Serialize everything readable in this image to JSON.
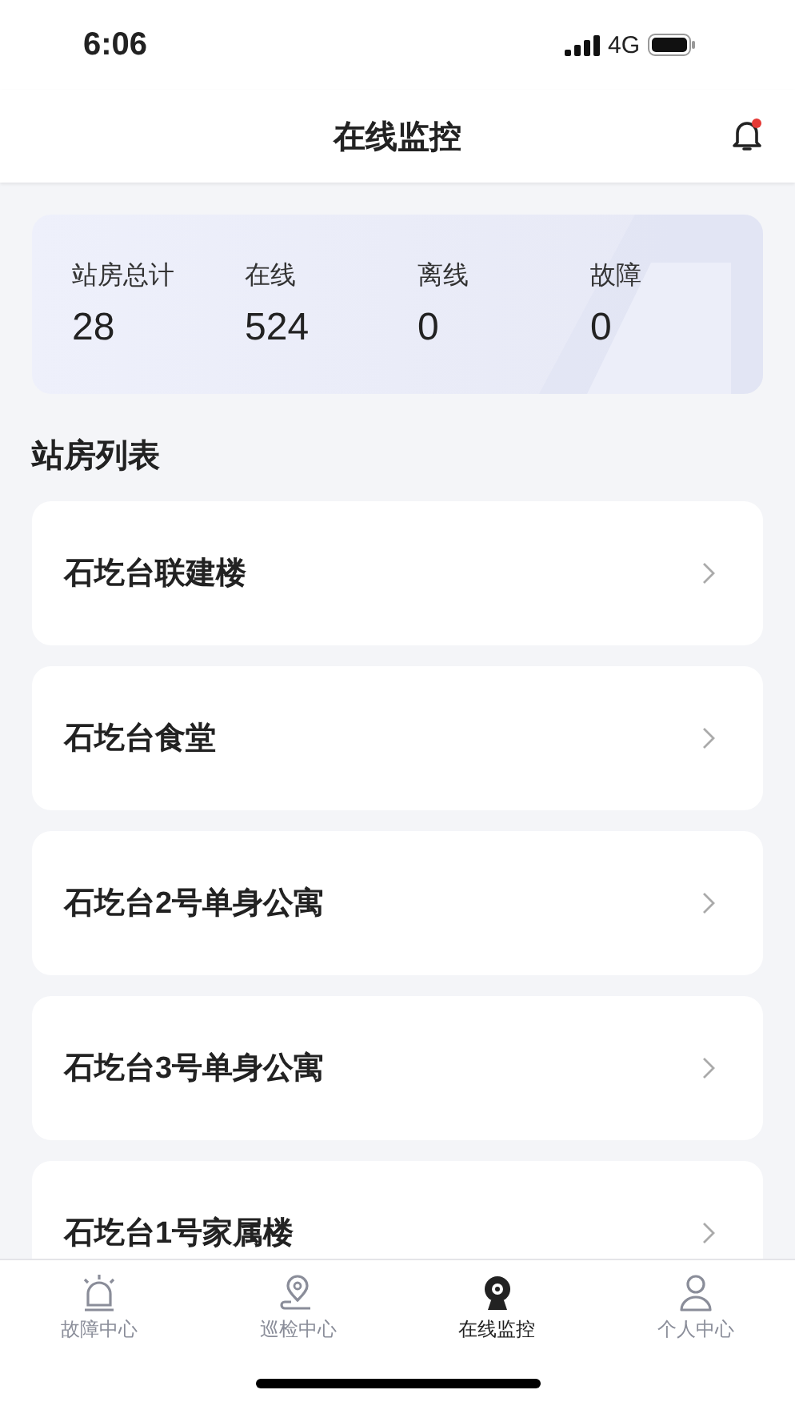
{
  "status_bar": {
    "time": "6:06",
    "network": "4G"
  },
  "header": {
    "title": "在线监控",
    "notification_dot": true
  },
  "summary": [
    {
      "label": "站房总计",
      "value": "28"
    },
    {
      "label": "在线",
      "value": "524"
    },
    {
      "label": "离线",
      "value": "0"
    },
    {
      "label": "故障",
      "value": "0"
    }
  ],
  "section_title": "站房列表",
  "stations": [
    {
      "name": "石圪台联建楼"
    },
    {
      "name": "石圪台食堂"
    },
    {
      "name": "石圪台2号单身公寓"
    },
    {
      "name": "石圪台3号单身公寓"
    },
    {
      "name": "石圪台1号家属楼"
    }
  ],
  "tabs": [
    {
      "kind": "alarm",
      "label": "故障中心",
      "selected": false
    },
    {
      "kind": "location",
      "label": "巡检中心",
      "selected": false
    },
    {
      "kind": "camera",
      "label": "在线监控",
      "selected": true
    },
    {
      "kind": "person",
      "label": "个人中心",
      "selected": false
    }
  ]
}
